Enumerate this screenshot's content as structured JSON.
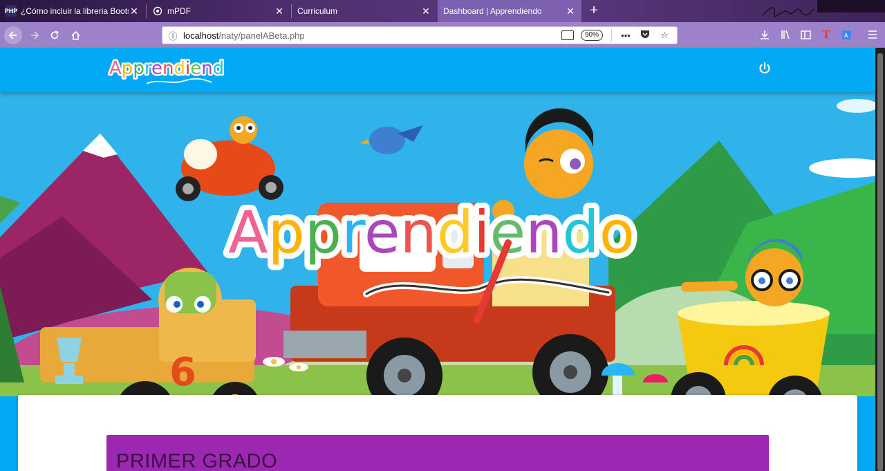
{
  "browser": {
    "tabs": [
      {
        "title": "¿Cómo incluir la libreria Bootstr",
        "favicon": "PHP"
      },
      {
        "title": "mPDF",
        "favicon": "mpdf-icon"
      },
      {
        "title": "Curriculum",
        "favicon": ""
      },
      {
        "title": "Dashboard | Apprendiendo",
        "favicon": "",
        "active": true
      }
    ],
    "url_host": "localhost",
    "url_path": "/naty/panelABeta.php",
    "zoom": "90%"
  },
  "app": {
    "logo_text": "Apprendiendo",
    "hero_logo_text": "Apprendiendo",
    "colors": {
      "appbar": "#03a9f4",
      "banner": "#9c27b0"
    }
  },
  "main": {
    "grade_title": "PRIMER GRADO"
  }
}
